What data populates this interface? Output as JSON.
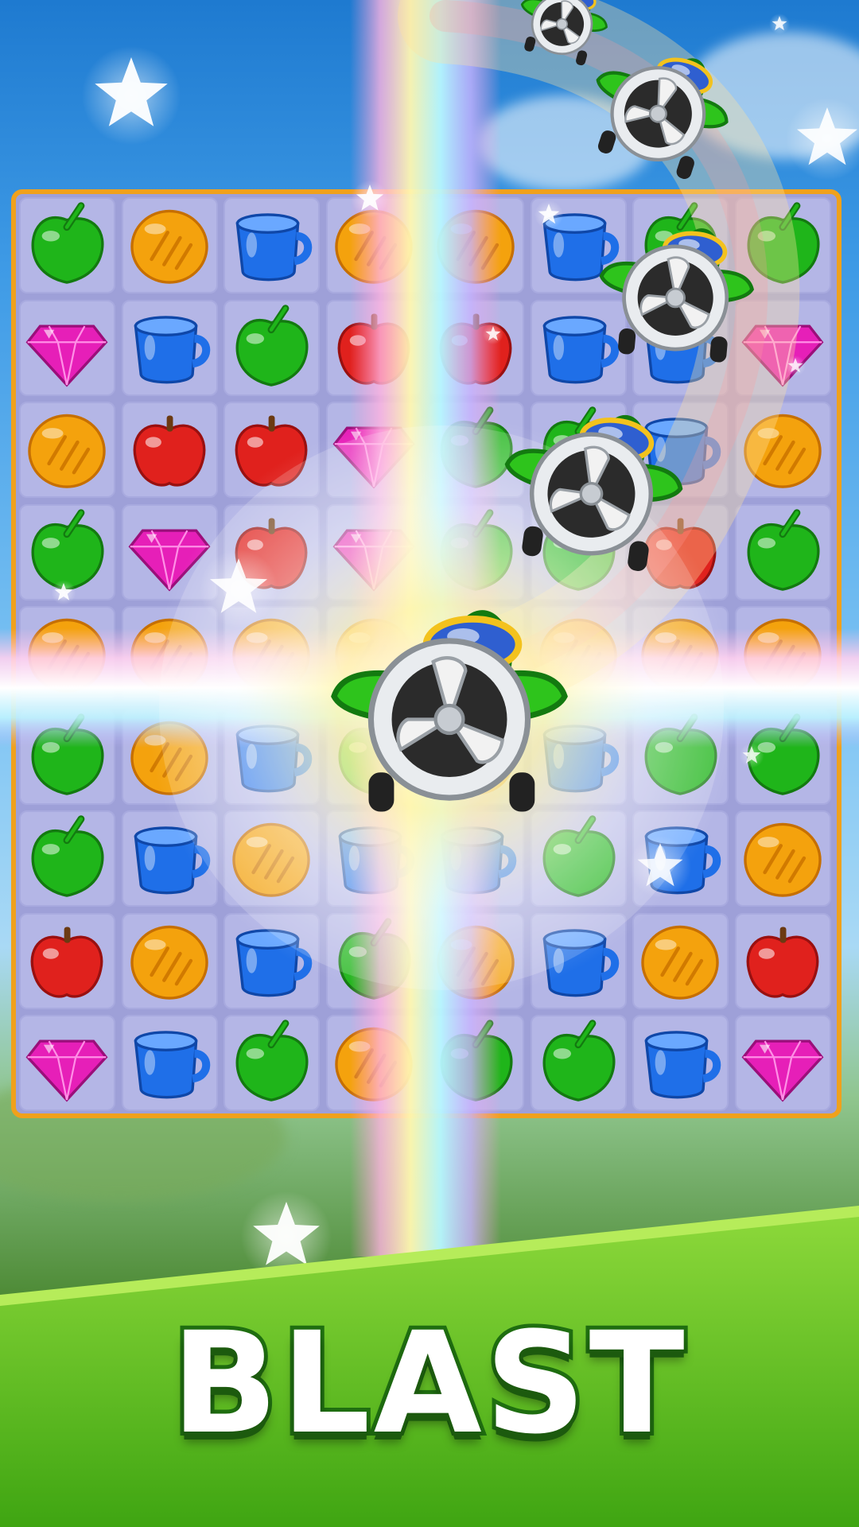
{
  "game": {
    "board": {
      "cols": 8,
      "rows": 9,
      "cells": [
        [
          "leaf",
          "bread",
          "cup",
          "bread",
          "bread",
          "cup",
          "leaf",
          "leaf"
        ],
        [
          "gem",
          "cup",
          "leaf",
          "apple",
          "apple",
          "cup",
          "cup",
          "gem"
        ],
        [
          "bread",
          "apple",
          "apple",
          "gem",
          "leaf",
          "leaf",
          "cup",
          "bread"
        ],
        [
          "leaf",
          "gem",
          "apple",
          "gem",
          "leaf",
          "leaf",
          "apple",
          "leaf"
        ],
        [
          "bread",
          "bread",
          "bread",
          "bread",
          "bread",
          "bread",
          "bread",
          "bread"
        ],
        [
          "leaf",
          "bread",
          "cup",
          "leaf",
          "bread",
          "cup",
          "leaf",
          "leaf"
        ],
        [
          "leaf",
          "cup",
          "bread",
          "cup",
          "cup",
          "leaf",
          "cup",
          "bread"
        ],
        [
          "apple",
          "bread",
          "cup",
          "leaf",
          "bread",
          "cup",
          "bread",
          "apple"
        ],
        [
          "gem",
          "cup",
          "leaf",
          "bread",
          "leaf",
          "leaf",
          "cup",
          "gem"
        ]
      ]
    },
    "piece_colors": {
      "leaf": "#1fb51a",
      "bread": "#f4a20d",
      "cup": "#1f6fe8",
      "apple": "#e0211d",
      "gem": "#e61fb8"
    },
    "booster": "airplane",
    "banner_text": "BLAST",
    "colors": {
      "board_border": "#f0a11c",
      "board_fill": "#9ea0d8",
      "banner_green": "#5ec11c",
      "airplane_green": "#2ec41c"
    }
  }
}
